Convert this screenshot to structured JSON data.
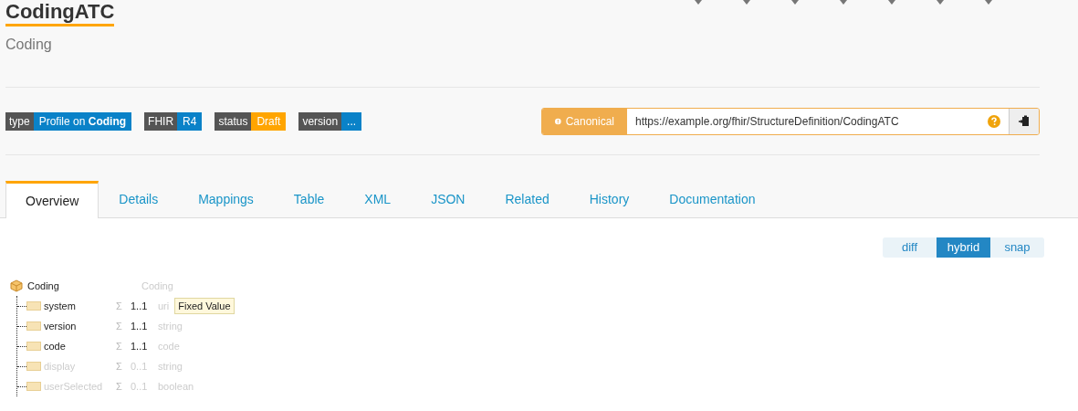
{
  "title": "CodingATC",
  "subtitle": "Coding",
  "badges": [
    {
      "label": "type",
      "value": "Profile on **Coding**",
      "color": "#0a82c8"
    },
    {
      "label": "FHIR",
      "value": "R4",
      "color": "#0a82c8"
    },
    {
      "label": "status",
      "value": "Draft",
      "color": "#ffa500"
    },
    {
      "label": "version",
      "value": "...",
      "color": "#0a82c8"
    }
  ],
  "canonical": {
    "label": "Canonical",
    "value": "https://example.org/fhir/StructureDefinition/CodingATC"
  },
  "tabs": [
    {
      "label": "Overview",
      "selected": true
    },
    {
      "label": "Details",
      "selected": false
    },
    {
      "label": "Mappings",
      "selected": false
    },
    {
      "label": "Table",
      "selected": false
    },
    {
      "label": "XML",
      "selected": false
    },
    {
      "label": "JSON",
      "selected": false
    },
    {
      "label": "Related",
      "selected": false
    },
    {
      "label": "History",
      "selected": false
    },
    {
      "label": "Documentation",
      "selected": false
    }
  ],
  "views": [
    {
      "label": "diff",
      "selected": false
    },
    {
      "label": "hybrid",
      "selected": true
    },
    {
      "label": "snap",
      "selected": false
    }
  ],
  "tree": {
    "name": "Coding",
    "type": "Coding",
    "children": [
      {
        "name": "system",
        "flag": "Σ",
        "card": "1..1",
        "type": "uri",
        "badge": "Fixed Value",
        "constrained": true
      },
      {
        "name": "version",
        "flag": "Σ",
        "card": "1..1",
        "type": "string",
        "constrained": true
      },
      {
        "name": "code",
        "flag": "Σ",
        "card": "1..1",
        "type": "code",
        "constrained": true
      },
      {
        "name": "display",
        "flag": "Σ",
        "card": "0..1",
        "type": "string",
        "constrained": false
      },
      {
        "name": "userSelected",
        "flag": "Σ",
        "card": "0..1",
        "type": "boolean",
        "constrained": false
      }
    ]
  }
}
